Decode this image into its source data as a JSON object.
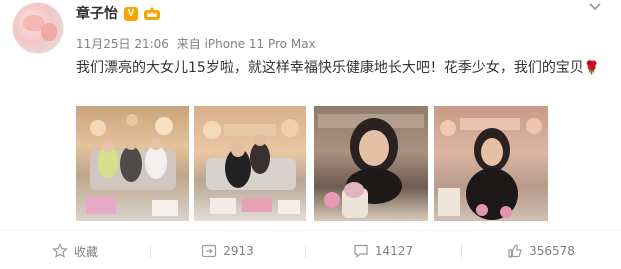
{
  "post": {
    "author": "章子怡",
    "vip_badge": "V",
    "date": "11月25日 21:06",
    "source": "来自 iPhone 11 Pro Max",
    "text": "我们漂亮的大女儿15岁啦，就这样幸福快乐健康地长大吧！花季少女，我们的宝贝",
    "emoji": "🌹",
    "photos": [
      {
        "name": "family-birthday-photo"
      },
      {
        "name": "mother-daughter-photo"
      },
      {
        "name": "blowing-candles-photo"
      },
      {
        "name": "birthday-girl-photo"
      }
    ]
  },
  "actions": {
    "favorite_label": "收藏",
    "repost_count": "2913",
    "comment_count": "14127",
    "like_count": "356578"
  },
  "colors": {
    "vip": "#f7a400",
    "meta_text": "#808080",
    "body_text": "#333333"
  },
  "icons": [
    "star-icon",
    "repost-icon",
    "comment-icon",
    "like-icon",
    "chevron-down-icon",
    "crown-icon"
  ]
}
